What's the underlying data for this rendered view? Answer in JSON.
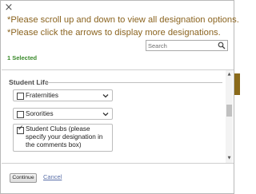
{
  "dialog": {
    "close_glyph": "×",
    "instructions": [
      "*Please scroll up and down to view all designation options.",
      "*Please click the arrows to display more designations."
    ],
    "instruction_color": "#8b6420"
  },
  "search": {
    "placeholder": "Search",
    "value": ""
  },
  "selected_count": "1 Selected",
  "section": {
    "title": "Student Life",
    "options": [
      {
        "label": "Fraternities",
        "checked": false,
        "check_glyph": ""
      },
      {
        "label": "Sororities",
        "checked": false,
        "check_glyph": ""
      },
      {
        "label": "Student Clubs (please specify your designation in the comments box)",
        "checked": true,
        "check_glyph": "✓"
      }
    ]
  },
  "scrollbar": {
    "up_glyph": "▲",
    "down_glyph": "▼"
  },
  "footer": {
    "continue_label": "Continue",
    "cancel_label": "Cancel"
  }
}
